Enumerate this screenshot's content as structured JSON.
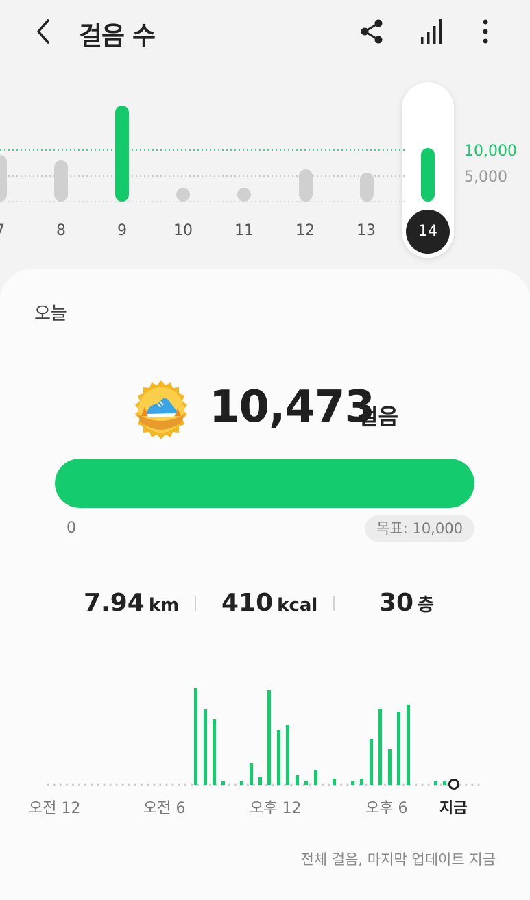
{
  "header": {
    "title": "걸음 수",
    "back_icon": "chevron-left-icon",
    "share_icon": "share-icon",
    "stats_icon": "bar-chart-icon",
    "more_icon": "more-vertical-icon"
  },
  "week_chart": {
    "goal_label": "10,000",
    "half_label": "5,000",
    "days": [
      "7",
      "8",
      "9",
      "10",
      "11",
      "12",
      "13"
    ],
    "selected_day": "14",
    "goal_met_color": "#14c96a",
    "below_goal_color": "#d0d0d0"
  },
  "today": {
    "label": "오늘",
    "medal_icon": "running-shoe-medal-icon",
    "steps": "10,473",
    "steps_unit": "걸음",
    "progress_fraction": 1.0,
    "progress_min": "0",
    "goal": "목표: 10,000",
    "accent_color": "#14cc6e"
  },
  "stats": {
    "distance": {
      "value": "7.94",
      "unit": "km"
    },
    "calories": {
      "value": "410",
      "unit": "kcal"
    },
    "floors": {
      "value": "30",
      "unit": "층"
    }
  },
  "hourly": {
    "labels": [
      "오전 12",
      "오전 6",
      "오후 12",
      "오후 6",
      "지금"
    ]
  },
  "footer": "전체 걸음, 마지막 업데이트 지금"
}
